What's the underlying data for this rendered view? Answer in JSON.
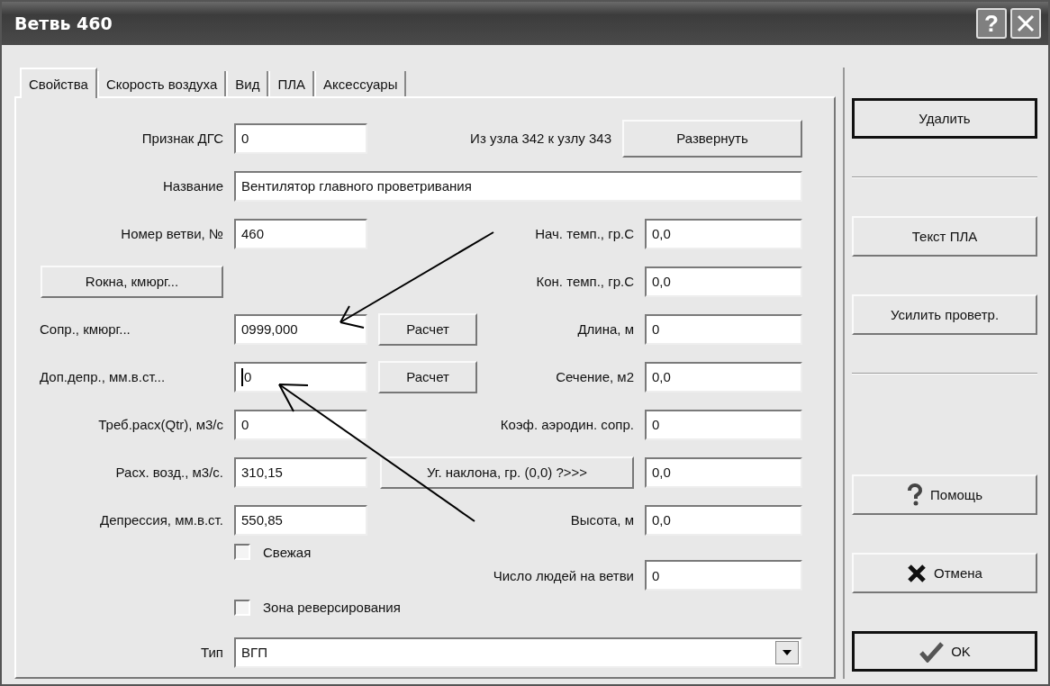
{
  "window": {
    "title": "Ветвь 460"
  },
  "title_buttons": [
    {
      "kind": "help",
      "label": "?"
    },
    {
      "kind": "close"
    }
  ],
  "tabs": [
    {
      "label": "Свойства",
      "selected": true
    },
    {
      "label": "Скорость воздуха",
      "selected": false
    },
    {
      "label": "Вид",
      "selected": false
    },
    {
      "label": "ПЛА",
      "selected": false
    },
    {
      "label": "Аксессуары",
      "selected": false
    }
  ],
  "rows": [
    {
      "left": {
        "kind": "field",
        "label": "Признак ДГС",
        "value": "0"
      },
      "right": {
        "kind": "node_info",
        "text": "Из узла 342 к узлу 343",
        "button": "Развернуть"
      }
    },
    {
      "left": {
        "kind": "wide_field",
        "label": "Название",
        "value": "Вентилятор главного проветривания"
      }
    },
    {
      "left": {
        "kind": "field",
        "label": "Номер ветви, №",
        "value": "460"
      },
      "right": {
        "kind": "field",
        "label": "Нач. темп., гр.С",
        "value": "0,0"
      }
    },
    {
      "left": {
        "kind": "button",
        "label": "Rокна, кмюрг..."
      },
      "right": {
        "kind": "field",
        "label": "Кон. темп., гр.С",
        "value": "0,0"
      }
    },
    {
      "left": {
        "kind": "calc_field",
        "label": "Сопр., кмюрг...",
        "value": "0999,000",
        "button": "Расчет",
        "focused": false
      },
      "right": {
        "kind": "field",
        "label": "Длина, м",
        "value": "0"
      }
    },
    {
      "left": {
        "kind": "calc_field",
        "label": "Доп.депр., мм.в.ст...",
        "value": "0",
        "button": "Расчет",
        "focused": true
      },
      "right": {
        "kind": "field",
        "label": "Сечение, м2",
        "value": "0,0"
      }
    },
    {
      "left": {
        "kind": "field",
        "label": "Треб.расх(Qtr), м3/с",
        "value": "0"
      },
      "right": {
        "kind": "field",
        "label": "Коэф. аэродин. сопр.",
        "value": "0"
      }
    },
    {
      "left": {
        "kind": "field",
        "label": "Расх. возд., м3/с.",
        "value": "310,15"
      },
      "right": {
        "kind": "button_field",
        "button": "Уг. наклона, гр. (0,0) ?>>>",
        "value": "0,0"
      }
    },
    {
      "left": {
        "kind": "field",
        "label": "Депрессия, мм.в.ст.",
        "value": "550,85"
      },
      "right": {
        "kind": "field",
        "label": "Высота, м",
        "value": "0,0"
      }
    },
    {
      "left": {
        "kind": "checkbox",
        "label": "Свежая",
        "checked": false
      },
      "right": {
        "kind": "field",
        "label": "Число людей на ветви",
        "value": "0"
      }
    },
    {
      "left": {
        "kind": "checkbox",
        "label": "Зона реверсирования",
        "checked": false
      }
    },
    {
      "left": {
        "kind": "select",
        "label": "Тип",
        "value": "ВГП"
      }
    }
  ],
  "actions": [
    {
      "kind": "button",
      "label": "Удалить",
      "default": true
    },
    {
      "kind": "separator"
    },
    {
      "kind": "button",
      "label": "Текст ПЛА",
      "default": false
    },
    {
      "kind": "button",
      "label": "Усилить проветр.",
      "default": false
    },
    {
      "kind": "separator"
    }
  ],
  "dialog_buttons": [
    {
      "kind": "help",
      "label": "Помощь",
      "default": false
    },
    {
      "kind": "cancel",
      "label": "Отмена",
      "default": false
    },
    {
      "kind": "ok",
      "label": "OK",
      "default": true
    }
  ]
}
